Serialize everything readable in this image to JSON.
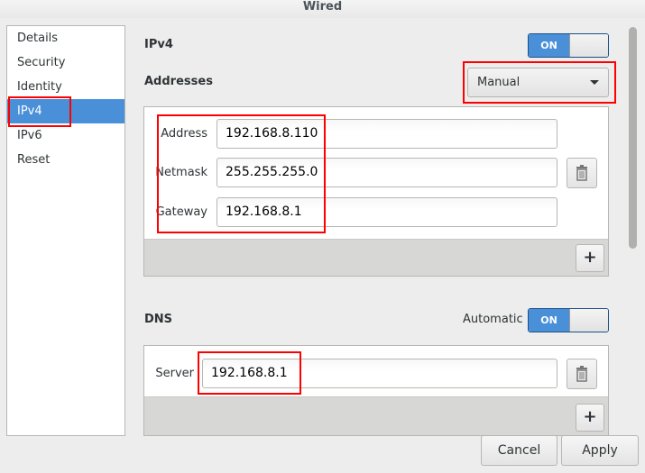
{
  "window": {
    "title": "Wired"
  },
  "sidebar": {
    "items": [
      {
        "label": "Details"
      },
      {
        "label": "Security"
      },
      {
        "label": "Identity"
      },
      {
        "label": "IPv4",
        "selected": true
      },
      {
        "label": "IPv6"
      },
      {
        "label": "Reset"
      }
    ]
  },
  "ipv4": {
    "title": "IPv4",
    "switch_label": "ON",
    "switch_on": true
  },
  "addresses": {
    "title": "Addresses",
    "method": "Manual",
    "address_label": "Address",
    "address": "192.168.8.110",
    "netmask_label": "Netmask",
    "netmask": "255.255.255.0",
    "gateway_label": "Gateway",
    "gateway": "192.168.8.1",
    "add_label": "+"
  },
  "dns": {
    "title": "DNS",
    "automatic_label": "Automatic",
    "switch_label": "ON",
    "switch_on": true,
    "server_label": "Server",
    "server": "192.168.8.1",
    "add_label": "+"
  },
  "buttons": {
    "cancel": "Cancel",
    "apply": "Apply"
  },
  "colors": {
    "accent": "#4a90d9",
    "highlight": "#ff0000"
  }
}
